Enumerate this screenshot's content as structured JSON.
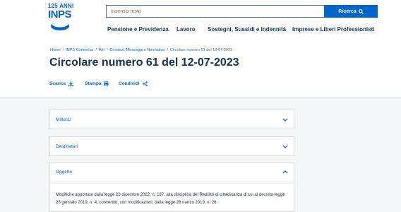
{
  "header": {
    "logo_anni": "125 ANNI",
    "logo_text": "INPS",
    "search_placeholder": "Inserisci testo",
    "search_button": "Ricerca",
    "nav": [
      {
        "label": "Pensione e Previdenza"
      },
      {
        "label": "Lavoro"
      },
      {
        "label": "Sostegni, Sussidi e Indennità"
      },
      {
        "label": "Imprese e Liberi Professionisti"
      }
    ]
  },
  "breadcrumb": [
    {
      "label": "Home"
    },
    {
      "label": "INPS Comunica"
    },
    {
      "label": "Atti"
    },
    {
      "label": "Circolari, Messaggi e Normativa"
    },
    {
      "label": "Circolare numero 61 del 12-07-2023"
    }
  ],
  "page_title": "Circolare numero 61 del 12-07-2023",
  "actions": {
    "download": "Scarica",
    "print": "Stampa",
    "share": "Condividi"
  },
  "accordions": [
    {
      "label": "Mittenti",
      "expanded": false
    },
    {
      "label": "Destinatari",
      "expanded": false
    },
    {
      "label": "Oggetto",
      "expanded": true
    }
  ],
  "oggetto_text": "Modifiche apportate dalla legge 29 dicembre 2022, n. 197, alla disciplina del Reddito di cittadinanza di cui al decreto-legge 28 gennaio 2019, n. 4, convertito, con modificazioni, dalla legge 28 marzo 2019, n. 26",
  "colors": {
    "primary": "#0066cc",
    "text": "#17324d",
    "background": "#f5f6f7"
  }
}
